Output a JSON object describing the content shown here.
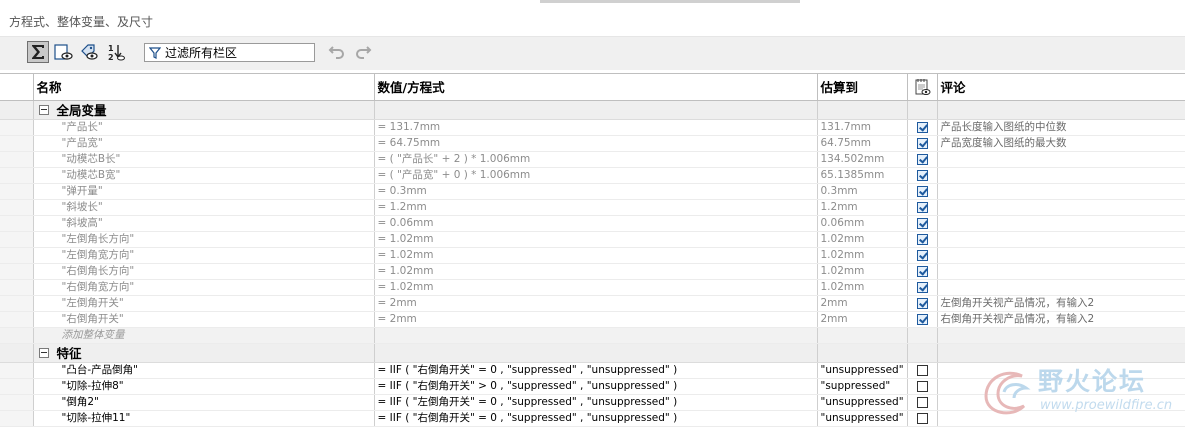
{
  "window": {
    "title": "方程式、整体变量、及尺寸"
  },
  "toolbar": {
    "buttons": [
      {
        "icon": "sigma-icon",
        "active": true
      },
      {
        "icon": "display-eye-icon",
        "active": false
      },
      {
        "icon": "tag-eye-icon",
        "active": false
      },
      {
        "icon": "sort-12-icon",
        "active": false
      }
    ],
    "filter_label": "过滤所有栏区",
    "undo_icon": "undo-icon",
    "redo_icon": "redo-icon"
  },
  "columns": {
    "name": "名称",
    "value": "数值/方程式",
    "evaluates": "估算到",
    "comment": "评论",
    "suppress_icon": "notepad-icon"
  },
  "sections": [
    {
      "title": "全局变量",
      "rows": [
        {
          "name": "\"产品长\"",
          "value": "= 131.7mm",
          "eval": "131.7mm",
          "checked": true,
          "comment": "产品长度输入图纸的中位数"
        },
        {
          "name": "\"产品宽\"",
          "value": "= 64.75mm",
          "eval": "64.75mm",
          "checked": true,
          "comment": "产品宽度输入图纸的最大数"
        },
        {
          "name": "\"动模芯B长\"",
          "value": "= ( \"产品长\" + 2 ) * 1.006mm",
          "eval": "134.502mm",
          "checked": true,
          "comment": ""
        },
        {
          "name": "\"动模芯B宽\"",
          "value": "= ( \"产品宽\" + 0 ) * 1.006mm",
          "eval": "65.1385mm",
          "checked": true,
          "comment": ""
        },
        {
          "name": "\"弹开量\"",
          "value": "= 0.3mm",
          "eval": "0.3mm",
          "checked": true,
          "comment": ""
        },
        {
          "name": "\"斜坡长\"",
          "value": "= 1.2mm",
          "eval": "1.2mm",
          "checked": true,
          "comment": ""
        },
        {
          "name": "\"斜坡高\"",
          "value": "= 0.06mm",
          "eval": "0.06mm",
          "checked": true,
          "comment": ""
        },
        {
          "name": "\"左倒角长方向\"",
          "value": "= 1.02mm",
          "eval": "1.02mm",
          "checked": true,
          "comment": ""
        },
        {
          "name": "\"左倒角宽方向\"",
          "value": "= 1.02mm",
          "eval": "1.02mm",
          "checked": true,
          "comment": ""
        },
        {
          "name": "\"右倒角长方向\"",
          "value": "= 1.02mm",
          "eval": "1.02mm",
          "checked": true,
          "comment": ""
        },
        {
          "name": "\"右倒角宽方向\"",
          "value": "= 1.02mm",
          "eval": "1.02mm",
          "checked": true,
          "comment": ""
        },
        {
          "name": "\"左倒角开关\"",
          "value": "= 2mm",
          "eval": "2mm",
          "checked": true,
          "comment": "左倒角开关视产品情况，有输入2"
        },
        {
          "name": "\"右倒角开关\"",
          "value": "= 2mm",
          "eval": "2mm",
          "checked": true,
          "comment": "右倒角开关视产品情况，有输入2"
        }
      ],
      "add_label": "添加整体变量"
    },
    {
      "title": "特征",
      "rows": [
        {
          "name": "\"凸台-产品倒角\"",
          "value": "= IIF ( \"右倒角开关\" = 0 , \"suppressed\" , \"unsuppressed\" )",
          "eval": "\"unsuppressed\"",
          "checked": false,
          "comment": ""
        },
        {
          "name": "\"切除-拉伸8\"",
          "value": "= IIF ( \"右倒角开关\" > 0 , \"suppressed\" , \"unsuppressed\" )",
          "eval": "\"suppressed\"",
          "checked": false,
          "comment": ""
        },
        {
          "name": "\"倒角2\"",
          "value": "= IIF ( \"左倒角开关\" = 0 , \"suppressed\" , \"unsuppressed\" )",
          "eval": "\"unsuppressed\"",
          "checked": false,
          "comment": ""
        },
        {
          "name": "\"切除-拉伸11\"",
          "value": "= IIF ( \"右倒角开关\" = 0 , \"suppressed\" , \"unsuppressed\" )",
          "eval": "\"unsuppressed\"",
          "checked": false,
          "comment": ""
        }
      ]
    }
  ],
  "watermark": {
    "text": "野火论坛",
    "url": "www.proewildfire.cn"
  },
  "colors": {
    "check_blue": "#1e5a9e",
    "section_bg": "#efefef",
    "grid_line": "#cfcfcf"
  }
}
